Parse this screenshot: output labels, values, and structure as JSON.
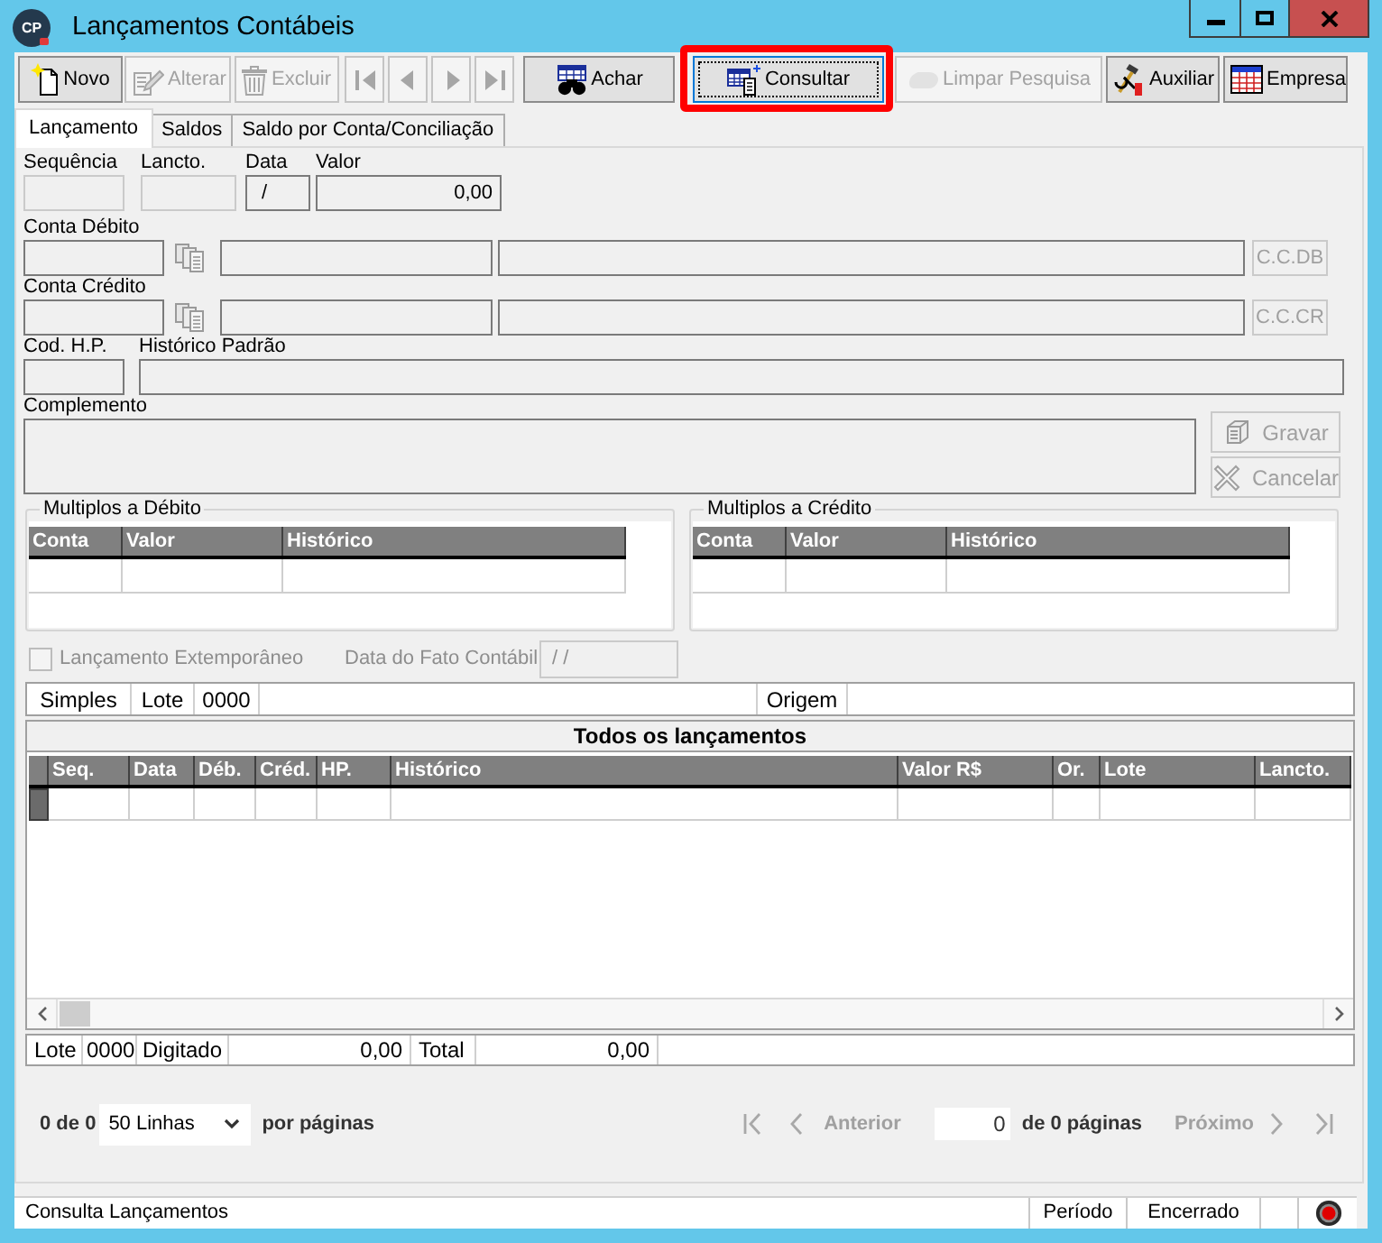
{
  "window": {
    "title": "Lançamentos Contábeis",
    "icon_text": "CP"
  },
  "toolbar": [
    {
      "kind": "command",
      "label": "Novo",
      "disabled": false,
      "focused": false,
      "highlighted": false
    },
    {
      "kind": "command",
      "label": "Alterar",
      "disabled": true,
      "focused": false,
      "highlighted": false
    },
    {
      "kind": "command",
      "label": "Excluir",
      "disabled": true,
      "focused": false,
      "highlighted": false
    },
    {
      "kind": "nav",
      "disabled": true,
      "focused": false,
      "highlighted": false
    },
    {
      "kind": "nav",
      "disabled": true,
      "focused": false,
      "highlighted": false
    },
    {
      "kind": "nav",
      "disabled": true,
      "focused": false,
      "highlighted": false
    },
    {
      "kind": "nav",
      "disabled": true,
      "focused": false,
      "highlighted": false
    },
    {
      "kind": "command",
      "label": "Achar",
      "disabled": false,
      "focused": false,
      "highlighted": false
    },
    {
      "kind": "command",
      "label": "Consultar",
      "disabled": false,
      "focused": true,
      "highlighted": true
    },
    {
      "kind": "command",
      "label": "Limpar Pesquisa",
      "disabled": true,
      "focused": false,
      "highlighted": false
    },
    {
      "kind": "command",
      "label": "Auxiliar",
      "disabled": false,
      "focused": false,
      "highlighted": false
    },
    {
      "kind": "command",
      "label": "Empresa",
      "disabled": false,
      "focused": false,
      "highlighted": false
    }
  ],
  "tabs": [
    {
      "label": "Lançamento",
      "selected": true
    },
    {
      "label": "Saldos",
      "selected": false
    },
    {
      "label": "Saldo por Conta/Conciliação",
      "selected": false
    }
  ],
  "entry": {
    "fields": [
      {
        "label": "Sequência",
        "disabled": true
      },
      {
        "label": "Lancto.",
        "disabled": true
      },
      {
        "label": "Data",
        "value": "/",
        "disabled": false
      },
      {
        "label": "Valor",
        "value": "0,00",
        "disabled": false
      }
    ],
    "accounts": [
      {
        "label": "Conta Débito",
        "button": {
          "label": "C.C.DB",
          "disabled": true
        }
      },
      {
        "label": "Conta Crédito",
        "button": {
          "label": "C.C.CR",
          "disabled": true
        }
      }
    ],
    "history": {
      "code_label": "Cod. H.P.",
      "label": "Histórico Padrão"
    },
    "complement": {
      "label": "Complemento"
    },
    "actions": [
      {
        "label": "Gravar",
        "disabled": true
      },
      {
        "label": "Cancelar",
        "disabled": true
      }
    ]
  },
  "multiples": [
    {
      "title": "Multiplos a Débito",
      "columns": [
        "Conta",
        "Valor",
        "Histórico"
      ]
    },
    {
      "title": "Multiplos a Crédito",
      "columns": [
        "Conta",
        "Valor",
        "Histórico"
      ]
    }
  ],
  "extemporaneous": {
    "label": "Lançamento Extemporâneo",
    "checked": false,
    "disabled": true
  },
  "fact_date": {
    "label": "Data do Fato Contábil",
    "value": "/ /",
    "disabled": true
  },
  "info_bar": {
    "cells": [
      "Simples",
      "Lote",
      "0000"
    ],
    "origin_label": "Origem"
  },
  "entries_grid": {
    "title": "Todos os lançamentos",
    "columns": [
      "Seq.",
      "Data",
      "Déb.",
      "Créd.",
      "HP.",
      "Histórico",
      "Valor R$",
      "Or.",
      "Lote",
      "Lancto."
    ]
  },
  "totals": {
    "batch_label": "Lote",
    "batch": "0000",
    "typed_label": "Digitado",
    "typed": "0,00",
    "total_label": "Total",
    "total": "0,00"
  },
  "pagination": {
    "count": "0 de 0",
    "page_size": "50 Linhas",
    "page_size_suffix": "por páginas",
    "previous": "Anterior",
    "previous_disabled": true,
    "page": "0",
    "page_total": "de 0 páginas",
    "next": "Próximo",
    "next_disabled": true
  },
  "status_bar": {
    "message": "Consulta Lançamentos",
    "period": "Período",
    "state": "Encerrado"
  }
}
